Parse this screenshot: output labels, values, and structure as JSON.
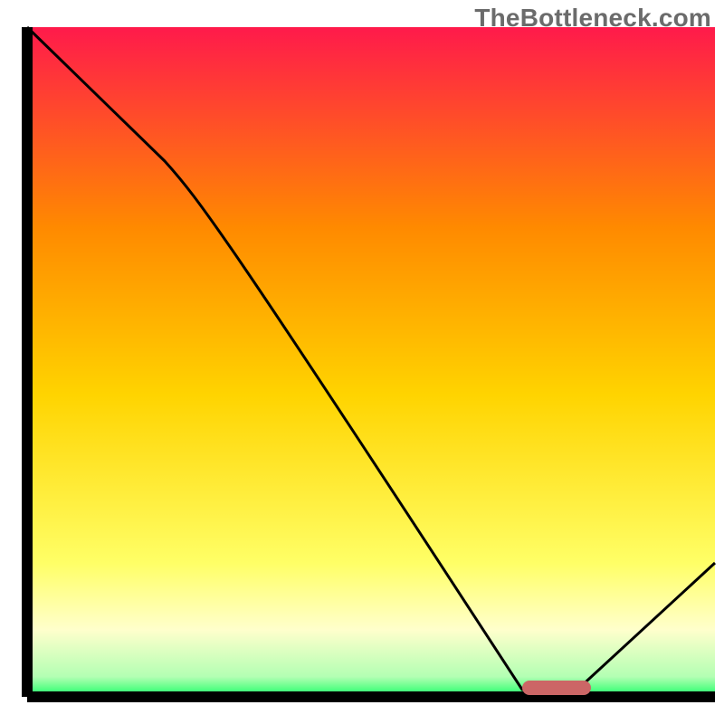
{
  "watermark": "TheBottleneck.com",
  "colors": {
    "grad_top": "#ff1a4b",
    "grad_mid1": "#ff8a00",
    "grad_mid2": "#ffd400",
    "grad_low1": "#ffff66",
    "grad_low2": "#ffffcc",
    "grad_bottom": "#19ff66",
    "axis": "#000000",
    "curve": "#000000",
    "marker": "#cc6666"
  },
  "chart_data": {
    "type": "line",
    "title": "",
    "xlabel": "",
    "ylabel": "",
    "xlim": [
      0,
      100
    ],
    "ylim": [
      0,
      100
    ],
    "grid": false,
    "legend": false,
    "background_gradient": {
      "orientation": "vertical",
      "stops": [
        {
          "y": 0,
          "color": "#19ff66"
        },
        {
          "y": 10,
          "color": "#ffffcc"
        },
        {
          "y": 18,
          "color": "#ffff66"
        },
        {
          "y": 45,
          "color": "#ffd400"
        },
        {
          "y": 70,
          "color": "#ff8a00"
        },
        {
          "y": 100,
          "color": "#ff1a4b"
        }
      ]
    },
    "series": [
      {
        "name": "bottleneck-curve",
        "x": [
          0,
          20,
          72,
          80,
          100
        ],
        "y": [
          100,
          80,
          1,
          1,
          20
        ]
      }
    ],
    "marker": {
      "x_start": 72,
      "x_end": 82,
      "y": 0.5
    }
  }
}
